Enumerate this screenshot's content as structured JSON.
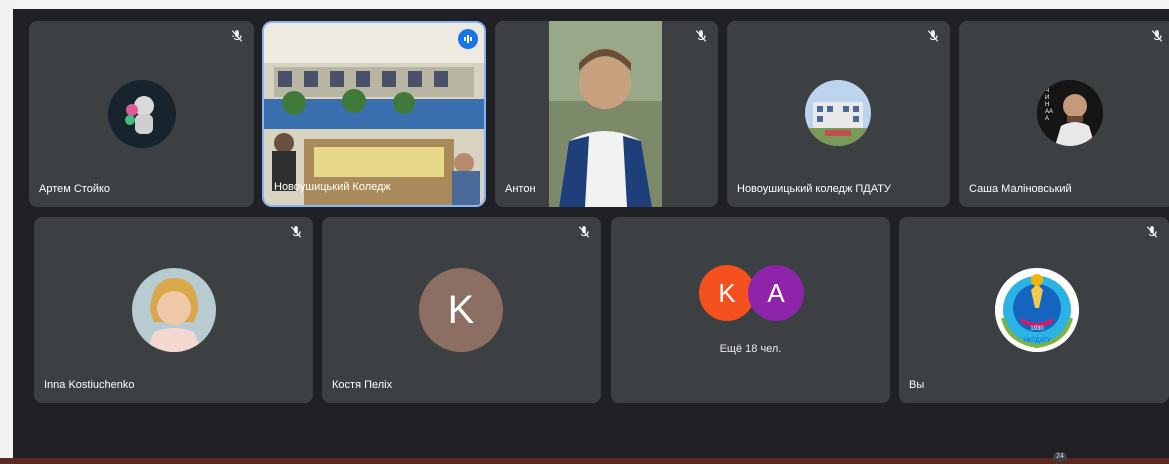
{
  "participants_row1": [
    {
      "name": "Артем Стойко",
      "avatar": "astronaut-avatar",
      "muted": true
    },
    {
      "name": "Новоушицький Коледж",
      "video": "classroom-video",
      "speaking": true
    },
    {
      "name": "Антон",
      "video": "camera-video",
      "muted": true
    },
    {
      "name": "Новоушицький коледж ПДАТУ",
      "avatar": "building-avatar",
      "muted": true
    },
    {
      "name": "Саша Маліновський",
      "avatar": "person-photo-avatar",
      "muted": true
    }
  ],
  "participants_row2": [
    {
      "name": "Inna Kostiuchenko",
      "avatar": "woman-photo-avatar",
      "muted": true
    },
    {
      "name": "Костя Пеліх",
      "letter": "K",
      "avatar_color": "#8d6e63",
      "muted": true
    },
    {
      "name": "",
      "more_text": "Ещё 18 чел.",
      "letters": [
        "K",
        "A"
      ],
      "letter_colors": [
        "#f4511e",
        "#8e24aa"
      ]
    },
    {
      "name": "Вы",
      "avatar": "college-emblem-avatar",
      "muted": true
    }
  ],
  "avatar_text": {
    "sasha_vertical": "ЧИНААА",
    "emblem_year": "1930",
    "emblem_caption": "НКПДАТУ"
  },
  "overlay_badge": "24",
  "colors": {
    "tile": "#3c4043",
    "background": "#202124",
    "accent": "#8ab4f8",
    "speaking": "#1a73e8"
  }
}
